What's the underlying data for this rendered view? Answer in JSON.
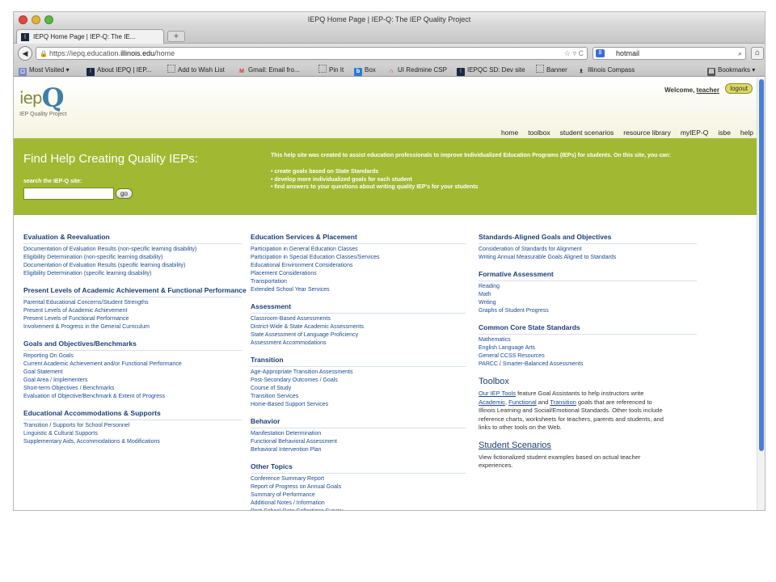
{
  "window": {
    "title": "IEPQ Home Page | IEP-Q: The IEP Quality Project",
    "tab_label": "IEPQ Home Page | IEP-Q: The IE...",
    "new_tab": "+",
    "url_prefix": "https://iepq.education.",
    "url_domain": "illinois.edu",
    "url_path": "/home",
    "search_value": "hotmail",
    "traffic_colors": [
      "#e2483f",
      "#e2b33b",
      "#5cb840"
    ]
  },
  "bookmarks": [
    {
      "label": "Most Visited ▾",
      "icon": "most-visited-icon"
    },
    {
      "label": "About IEPQ | IEP...",
      "icon": "illinois-icon"
    },
    {
      "label": "Add to Wish List",
      "icon": "page-icon"
    },
    {
      "label": "Gmail: Email fro...",
      "icon": "gmail-icon"
    },
    {
      "label": "Pin It",
      "icon": "page-icon"
    },
    {
      "label": "Box",
      "icon": "box-icon"
    },
    {
      "label": "UI Redmine CSP",
      "icon": "redmine-icon"
    },
    {
      "label": "IEPQC SD: Dev site",
      "icon": "illinois-icon"
    },
    {
      "label": "Banner",
      "icon": "page-icon"
    },
    {
      "label": "Illinois Compass",
      "icon": "compass-icon"
    }
  ],
  "bookmarks_menu": "Bookmarks ▾",
  "header": {
    "logo_iep": "iep",
    "logo_q": "Q",
    "logo_sub": "IEP Quality Project",
    "welcome": "Welcome, ",
    "user": "teacher",
    "logout": "logout",
    "nav": [
      "home",
      "toolbox",
      "student scenarios",
      "resource library",
      "myIEP-Q",
      "isbe",
      "help"
    ]
  },
  "banner": {
    "title": "Find Help Creating Quality IEPs:",
    "search_label": "search the IEP-Q site:",
    "go": "go",
    "intro": "This help site was created to assist education professionals to improve Individualized Education Programs (IEPs) for students. On this site, you can:",
    "bullets": [
      "create goals based on State Standards",
      "develop more individualized goals for each student",
      "find answers to your questions about writing quality IEP's for your students"
    ],
    "color": "#a1b833"
  },
  "col1": [
    {
      "title": "Evaluation & Reevaluation",
      "links": [
        "Documentation of Evaluation Results (non-specific learning disability)",
        "Eligibility Determination (non-specific learning disability)",
        "Documentation of Evaluation Results (specific learning disability)",
        "Eligibility Determination (specific learning disability)"
      ]
    },
    {
      "title": "Present Levels of Academic Achievement & Functional Performance",
      "links": [
        "Parental Educational Concerns/Student Strengths",
        "Present Levels of Academic Achievement",
        "Present Levels of Functional Performance",
        "Involvement & Progress in the General Curriculum"
      ]
    },
    {
      "title": "Goals and Objectives/Benchmarks",
      "links": [
        "Reporting On Goals",
        "Current Academic Achievement and/or Functional Performance",
        "Goal Statement",
        "Goal Area / Implementers",
        "Short-term Objectives / Benchmarks",
        "Evaluation of Objective/Benchmark & Extent of Progress"
      ]
    },
    {
      "title": "Educational Accommodations & Supports",
      "links": [
        "Transition / Supports for School Personnel",
        "Linguistic & Cultural Supports",
        "Supplementary Aids, Accommodations & Modifications"
      ]
    }
  ],
  "col2": [
    {
      "title": "Education Services & Placement",
      "links": [
        "Participation in General Education Classes",
        "Participation in Special Education Classes/Services",
        "Educational Environment Considerations",
        "Placement Considerations",
        "Transportation",
        "Extended School Year Services"
      ]
    },
    {
      "title": "Assessment",
      "links": [
        "Classroom-Based Assessments",
        "District-Wide & State Academic Assessments",
        "State Assessment of Language Proficiency",
        "Assessment Accommodations"
      ]
    },
    {
      "title": "Transition",
      "links": [
        "Age-Appropriate Transition Assessments",
        "Post-Secondary Outcomes / Goals",
        "Course of Study",
        "Transition Services",
        "Home-Based Support Services"
      ]
    },
    {
      "title": "Behavior",
      "links": [
        "Manifestation Determination",
        "Functional Behavioral Assessment",
        "Behavioral Intervention Plan"
      ]
    },
    {
      "title": "Other Topics",
      "links": [
        "Conference Summary Report",
        "Report of Progress on Annual Goals",
        "Summary of Performance",
        "Additional Notes / Information",
        "Post-School Data Collections Survey"
      ]
    }
  ],
  "col3": [
    {
      "title": "Standards-Aligned Goals and Objectives",
      "links": [
        "Consideration of Standards for Alignment",
        "Writing Annual Measurable Goals Aligned to Standards"
      ]
    },
    {
      "title": "Formative Assessment",
      "links": [
        "Reading",
        "Math",
        "Writing",
        "Graphs of Student Progress"
      ]
    },
    {
      "title": "Common Core State Standards",
      "links": [
        "Mathematics",
        "English Language Arts",
        "General CCSS Resources",
        "PARCC / Smarter-Balanced Assessments"
      ]
    }
  ],
  "toolbox": {
    "title": "Toolbox",
    "link_tools": "Our IEP Tools",
    "t1": " feature Goal Assistants to help instructors write ",
    "link_academic": "Academic",
    "t2": ", ",
    "link_functional": "Functional",
    "t3": " and ",
    "link_transition": "Transition",
    "t4": " goals that are referenced to Illinois Learning and Social/Emotional Standards. Other tools include reference charts, worksheets for teachers, parents and students, and links to other tools on the Web."
  },
  "scenarios": {
    "title": "Student Scenarios",
    "text": "View fictionalized student examples based on actual teacher experiences."
  }
}
